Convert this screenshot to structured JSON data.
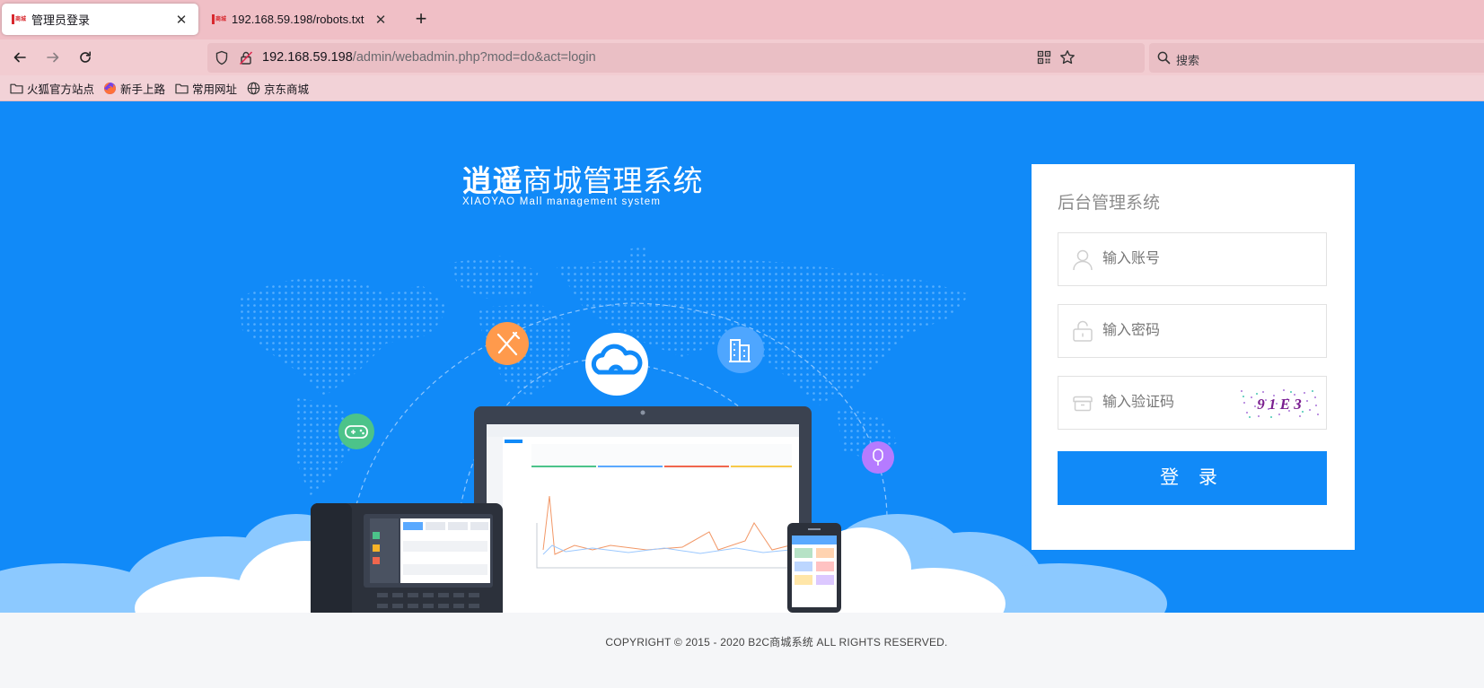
{
  "browser": {
    "tabs": [
      {
        "title": "管理员登录",
        "active": true,
        "favicon_text": "商城"
      },
      {
        "title": "192.168.59.198/robots.txt",
        "active": false,
        "favicon_text": "商城"
      }
    ],
    "new_tab_icon": "plus-icon",
    "nav": {
      "back_icon": "arrow-left-icon",
      "forward_icon": "arrow-right-icon",
      "reload_icon": "reload-icon"
    },
    "url": {
      "host": "192.168.59.198",
      "path": "/admin/webadmin.php?mod=do&act=login"
    },
    "search_placeholder": "搜索",
    "bookmarks": [
      {
        "label": "火狐官方站点",
        "icon": "folder-icon"
      },
      {
        "label": "新手上路",
        "icon": "firefox-icon"
      },
      {
        "label": "常用网址",
        "icon": "folder-icon"
      },
      {
        "label": "京东商城",
        "icon": "globe-icon"
      }
    ],
    "theme_color": "#f0bfc6"
  },
  "brand": {
    "title_bold": "逍遥",
    "title_rest": "商城管理系统",
    "subtitle": "XIAOYAO Mall management system"
  },
  "login": {
    "title": "后台管理系统",
    "username_placeholder": "输入账号",
    "password_placeholder": "输入密码",
    "captcha_placeholder": "输入验证码",
    "captcha_text": "9 1 E 3",
    "submit_label": "登 录"
  },
  "footer": {
    "copyright": "COPYRIGHT © 2015 - 2020 B2C商城系统 ALL RIGHTS RESERVED."
  },
  "colors": {
    "primary": "#118af8",
    "footer_bg": "#f5f6f8"
  }
}
